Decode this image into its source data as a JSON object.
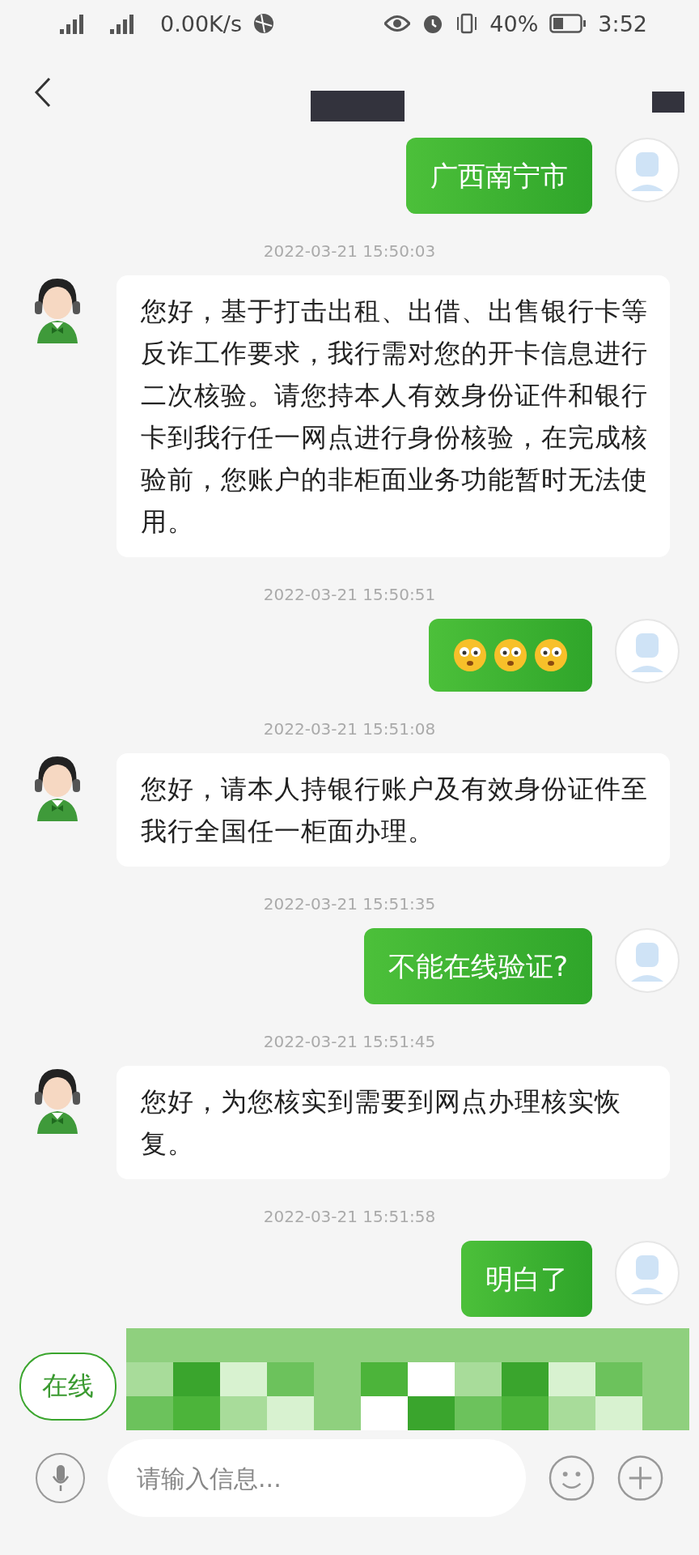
{
  "status_bar": {
    "speed": "0.00K/s",
    "battery": "40%",
    "time": "3:52"
  },
  "messages": [
    {
      "kind": "user",
      "text": "广西南宁市"
    },
    {
      "kind": "time",
      "text": "2022-03-21 15:50:03"
    },
    {
      "kind": "agent",
      "text": "您好，基于打击出租、出借、出售银行卡等反诈工作要求，我行需对您的开卡信息进行二次核验。请您持本人有效身份证件和银行卡到我行任一网点进行身份核验，在完成核验前，您账户的非柜面业务功能暂时无法使用。"
    },
    {
      "kind": "time",
      "text": "2022-03-21 15:50:51"
    },
    {
      "kind": "emoji",
      "emojis": [
        {
          "kind": "surprised"
        },
        {
          "kind": "surprised"
        },
        {
          "kind": "surprised"
        }
      ]
    },
    {
      "kind": "time",
      "text": "2022-03-21 15:51:08"
    },
    {
      "kind": "agent",
      "text": "您好，请本人持银行账户及有效身份证件至我行全国任一柜面办理。"
    },
    {
      "kind": "time",
      "text": "2022-03-21 15:51:35"
    },
    {
      "kind": "user",
      "text": "不能在线验证?"
    },
    {
      "kind": "time",
      "text": "2022-03-21 15:51:45"
    },
    {
      "kind": "agent",
      "text": "您好，为您核实到需要到网点办理核实恢复。"
    },
    {
      "kind": "time",
      "text": "2022-03-21 15:51:58"
    },
    {
      "kind": "user",
      "text": "明白了"
    }
  ],
  "quick_chip": {
    "label": "在线"
  },
  "input": {
    "placeholder": "请输入信息..."
  }
}
